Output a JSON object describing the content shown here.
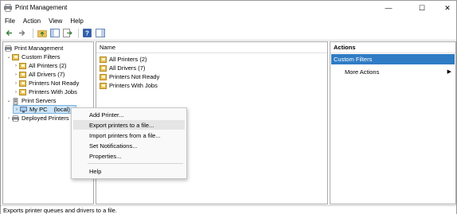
{
  "window": {
    "title": "Print Management"
  },
  "controls": {
    "minimize": "—",
    "maximize": "☐",
    "close": "✕"
  },
  "menu": [
    "File",
    "Action",
    "View",
    "Help"
  ],
  "tree": {
    "root": "Print Management",
    "custom_filters": "Custom Filters",
    "filters": [
      "All Printers (2)",
      "All Drivers (7)",
      "Printers Not Ready",
      "Printers With Jobs"
    ],
    "print_servers": "Print Servers",
    "my_pc": "My PC",
    "local": "(local)",
    "deployed": "Deployed Printers"
  },
  "list": {
    "header": "Name",
    "items": [
      "All Printers (2)",
      "All Drivers (7)",
      "Printers Not Ready",
      "Printers With Jobs"
    ]
  },
  "actions": {
    "header": "Actions",
    "section": "Custom Filters",
    "more": "More Actions"
  },
  "context_menu": {
    "items": [
      "Add Printer...",
      "Export printers to a file...",
      "Import printers from a file...",
      "Set Notifications...",
      "Properties...",
      "Help"
    ]
  },
  "status": "Exports printer queues and drivers to a file.",
  "colors": {
    "accent": "#2f7cc4",
    "selection": "#cce4f7",
    "folder": "#e8c15a"
  }
}
